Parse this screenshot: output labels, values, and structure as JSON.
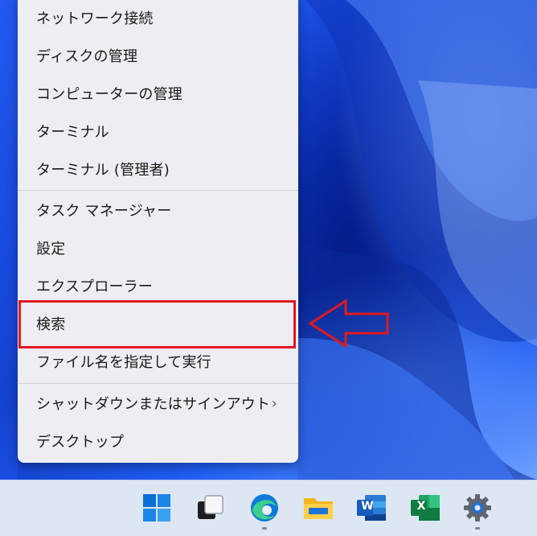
{
  "context_menu": {
    "items": [
      {
        "label": "ネットワーク接続"
      },
      {
        "label": "ディスクの管理"
      },
      {
        "label": "コンピューターの管理"
      },
      {
        "label": "ターミナル"
      },
      {
        "label": "ターミナル (管理者)"
      },
      {
        "label": "タスク マネージャー"
      },
      {
        "label": "設定"
      },
      {
        "label": "エクスプローラー"
      },
      {
        "label": "検索"
      },
      {
        "label": "ファイル名を指定して実行"
      },
      {
        "label": "シャットダウンまたはサインアウト",
        "submenu_glyph": "›"
      },
      {
        "label": "デスクトップ"
      }
    ],
    "highlighted_item": "検索",
    "highlight_color": "#e0191f"
  },
  "taskbar": {
    "icons": [
      {
        "name": "start-icon"
      },
      {
        "name": "task-view-icon"
      },
      {
        "name": "edge-icon"
      },
      {
        "name": "file-explorer-icon"
      },
      {
        "name": "word-icon",
        "letter": "W"
      },
      {
        "name": "excel-icon",
        "letter": "X"
      },
      {
        "name": "settings-icon"
      }
    ]
  }
}
